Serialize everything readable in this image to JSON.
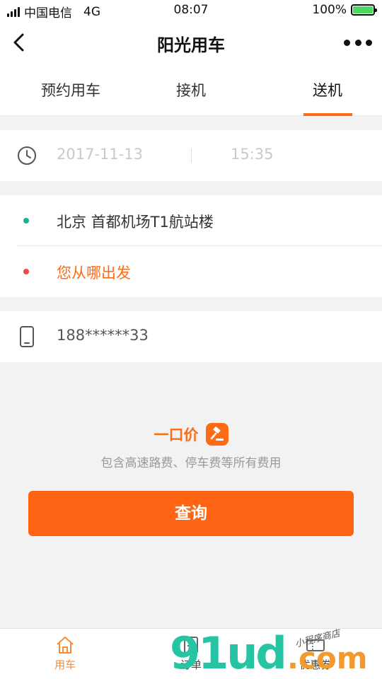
{
  "status_bar": {
    "carrier": "中国电信",
    "network": "4G",
    "time": "08:07",
    "battery": "100%",
    "battery_level": 1.0
  },
  "nav": {
    "title": "阳光用车"
  },
  "tabs": [
    {
      "label": "预约用车",
      "active": false
    },
    {
      "label": "接机",
      "active": false
    },
    {
      "label": "送机",
      "active": true
    }
  ],
  "booking": {
    "date": "2017-11-13",
    "time": "15:35",
    "pickup": "北京 首都机场T1航站楼",
    "destination_placeholder": "您从哪出发",
    "phone": "188******33"
  },
  "price": {
    "title": "一口价",
    "description": "包含高速路费、停车费等所有费用"
  },
  "query_button": "查询",
  "tabbar": [
    {
      "label": "用车",
      "icon": "home-icon",
      "active": true
    },
    {
      "label": "订单",
      "icon": "order-icon",
      "active": false
    },
    {
      "label": "优惠券",
      "icon": "coupon-icon",
      "active": false
    }
  ],
  "watermark": {
    "main": "91ud",
    "suffix": ".com",
    "tagline": "小程序商店"
  },
  "colors": {
    "accent": "#ff6414",
    "pickup_dot": "#1ab394",
    "destination_dot": "#e84a4a",
    "destination_text": "#ff6a14",
    "tab_active": "#ff8a34"
  }
}
